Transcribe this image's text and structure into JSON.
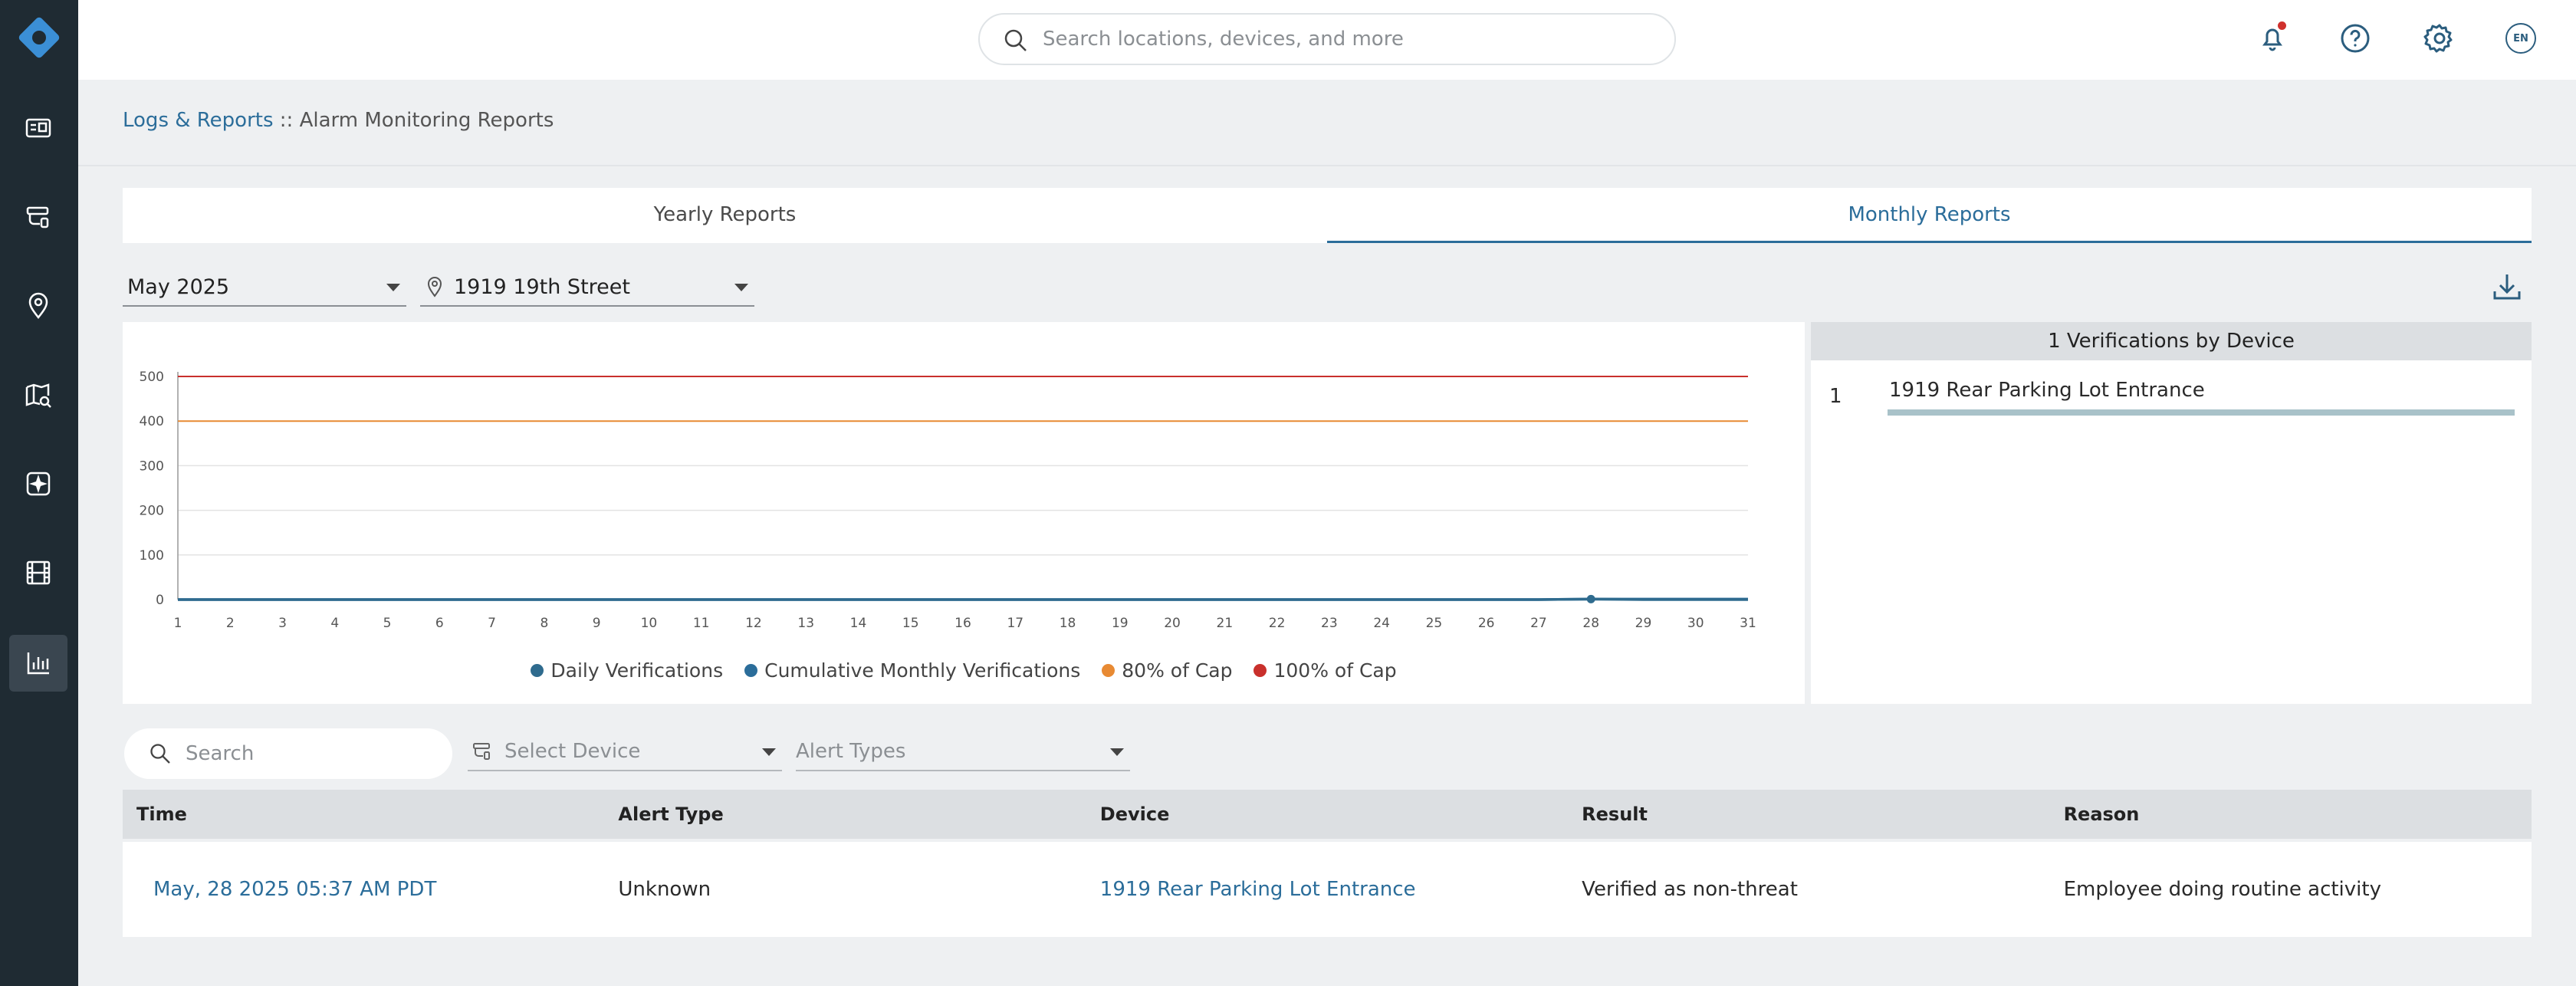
{
  "colors": {
    "accent": "#2b6d9a",
    "sidebar_bg": "#1f2b33",
    "logo": "#3b8fd6",
    "notification_dot": "#d0312d",
    "series_daily": "#2f6b8e",
    "series_cumulative": "#2b6d9a",
    "cap_80": "#e88a33",
    "cap_100": "#c9302c",
    "device_bar": "#a9c2c9"
  },
  "sidebar": {
    "items": [
      {
        "icon": "dashboard-icon"
      },
      {
        "icon": "device-icon"
      },
      {
        "icon": "location-pin-icon"
      },
      {
        "icon": "map-search-icon"
      },
      {
        "icon": "alert-center-icon"
      },
      {
        "icon": "video-film-icon"
      },
      {
        "icon": "reports-chart-icon",
        "active": true
      }
    ]
  },
  "topbar": {
    "search_placeholder": "Search locations, devices, and more",
    "language": "EN"
  },
  "breadcrumb": {
    "parent": "Logs & Reports",
    "separator": " :: ",
    "current": "Alarm Monitoring Reports"
  },
  "tabs": [
    {
      "label": "Yearly Reports",
      "active": false
    },
    {
      "label": "Monthly Reports",
      "active": true
    }
  ],
  "filters": {
    "month": "May 2025",
    "location": "1919 19th Street"
  },
  "chart_data": {
    "type": "line",
    "x": [
      1,
      2,
      3,
      4,
      5,
      6,
      7,
      8,
      9,
      10,
      11,
      12,
      13,
      14,
      15,
      16,
      17,
      18,
      19,
      20,
      21,
      22,
      23,
      24,
      25,
      26,
      27,
      28,
      29,
      30,
      31
    ],
    "xticks": [
      "1",
      "2",
      "3",
      "4",
      "5",
      "6",
      "7",
      "8",
      "9",
      "10",
      "11",
      "12",
      "13",
      "14",
      "15",
      "16",
      "17",
      "18",
      "19",
      "20",
      "21",
      "22",
      "23",
      "24",
      "25",
      "26",
      "27",
      "28",
      "29",
      "30",
      "31"
    ],
    "yticks": [
      "0",
      "100",
      "200",
      "300",
      "400",
      "500"
    ],
    "ylim": [
      0,
      500
    ],
    "series": [
      {
        "name": "Daily Verifications",
        "values": [
          0,
          0,
          0,
          0,
          0,
          0,
          0,
          0,
          0,
          0,
          0,
          0,
          0,
          0,
          0,
          0,
          0,
          0,
          0,
          0,
          0,
          0,
          0,
          0,
          0,
          0,
          0,
          1,
          0,
          0,
          0
        ],
        "color": "#2f6b8e"
      },
      {
        "name": "Cumulative Monthly Verifications",
        "values": [
          0,
          0,
          0,
          0,
          0,
          0,
          0,
          0,
          0,
          0,
          0,
          0,
          0,
          0,
          0,
          0,
          0,
          0,
          0,
          0,
          0,
          0,
          0,
          0,
          0,
          0,
          0,
          1,
          1,
          1,
          1
        ],
        "color": "#2b6d9a"
      },
      {
        "name": "80% of Cap",
        "values": [
          400,
          400,
          400,
          400,
          400,
          400,
          400,
          400,
          400,
          400,
          400,
          400,
          400,
          400,
          400,
          400,
          400,
          400,
          400,
          400,
          400,
          400,
          400,
          400,
          400,
          400,
          400,
          400,
          400,
          400,
          400
        ],
        "color": "#e88a33"
      },
      {
        "name": "100% of Cap",
        "values": [
          500,
          500,
          500,
          500,
          500,
          500,
          500,
          500,
          500,
          500,
          500,
          500,
          500,
          500,
          500,
          500,
          500,
          500,
          500,
          500,
          500,
          500,
          500,
          500,
          500,
          500,
          500,
          500,
          500,
          500,
          500
        ],
        "color": "#c9302c"
      }
    ],
    "legend": [
      "Daily Verifications",
      "Cumulative Monthly Verifications",
      "80% of Cap",
      "100% of Cap"
    ],
    "legend_position": "bottom",
    "grid": true
  },
  "device_panel": {
    "title": "1 Verifications by Device",
    "rows": [
      {
        "rank": "1",
        "name": "1919 Rear Parking Lot Entrance",
        "count": 1
      }
    ]
  },
  "table_filters": {
    "search_placeholder": "Search",
    "device_placeholder": "Select Device",
    "alert_placeholder": "Alert Types"
  },
  "table": {
    "headers": [
      "Time",
      "Alert Type",
      "Device",
      "Result",
      "Reason"
    ],
    "rows": [
      {
        "time": "May, 28 2025 05:37 AM PDT",
        "alert_type": "Unknown",
        "device": "1919 Rear Parking Lot Entrance",
        "result": "Verified as non-threat",
        "reason": "Employee doing routine activity"
      }
    ]
  }
}
